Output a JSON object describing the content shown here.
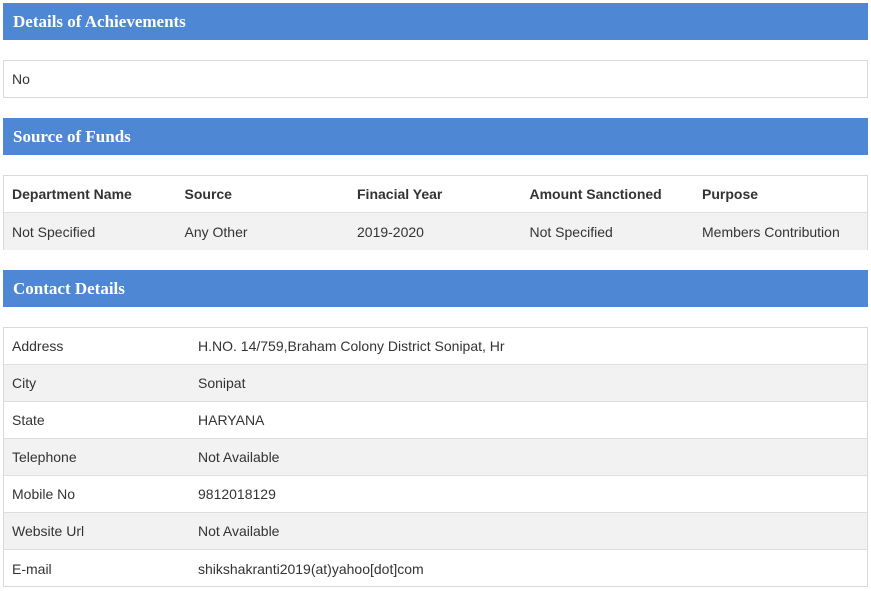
{
  "achievements": {
    "title": "Details of Achievements",
    "value": "No"
  },
  "funds": {
    "title": "Source of Funds",
    "columns": [
      "Department Name",
      "Source",
      "Finacial Year",
      "Amount Sanctioned",
      "Purpose"
    ],
    "rows": [
      [
        "Not Specified",
        "Any Other",
        "2019-2020",
        "Not Specified",
        "Members Contribution"
      ]
    ]
  },
  "contact": {
    "title": "Contact Details",
    "rows": [
      {
        "label": "Address",
        "value": "H.NO. 14/759,Braham Colony District Sonipat, Hr"
      },
      {
        "label": "City",
        "value": "Sonipat"
      },
      {
        "label": "State",
        "value": "HARYANA"
      },
      {
        "label": "Telephone",
        "value": "Not Available"
      },
      {
        "label": "Mobile No",
        "value": "9812018129"
      },
      {
        "label": "Website Url",
        "value": "Not Available"
      },
      {
        "label": "E-mail",
        "value": "shikshakranti2019(at)yahoo[dot]com"
      }
    ]
  },
  "colors": {
    "header_bg": "#4e87d4",
    "header_text": "#ffffff",
    "alt_row": "#f2f2f2",
    "border": "#d9d9d9"
  }
}
